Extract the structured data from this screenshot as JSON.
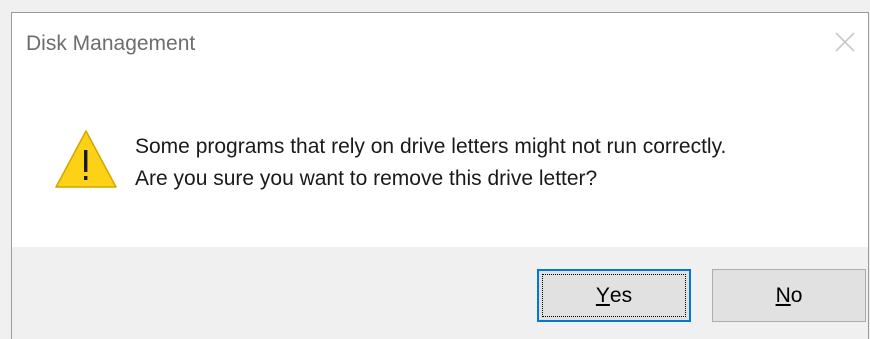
{
  "dialog": {
    "title": "Disk Management",
    "message_line1": "Some programs that rely on drive letters might not run correctly.",
    "message_line2": "Are you sure you want to remove this drive letter?",
    "icon": "warning-icon",
    "buttons": {
      "yes": {
        "accel": "Y",
        "rest": "es"
      },
      "no": {
        "accel": "N",
        "rest": "o"
      }
    }
  },
  "colors": {
    "accent": "#0078d7",
    "warning_fill": "#fcd116"
  }
}
